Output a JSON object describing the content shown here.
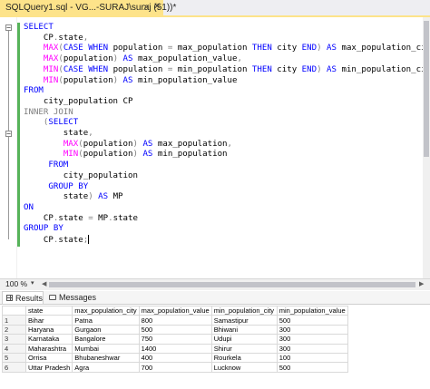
{
  "tab": {
    "title": "SQLQuery1.sql - VG...-SURAJ\\suraj (51))*"
  },
  "tab_icons": {
    "pin": "pin-icon",
    "close": "close-icon"
  },
  "code_lines": [
    [
      [
        "kw",
        "SELECT"
      ]
    ],
    [
      [
        "txt",
        "    CP"
      ],
      [
        "op",
        "."
      ],
      [
        "txt",
        "state"
      ],
      [
        "op",
        ","
      ]
    ],
    [
      [
        "txt",
        "    "
      ],
      [
        "fn",
        "MAX"
      ],
      [
        "op",
        "("
      ],
      [
        "kw",
        "CASE WHEN "
      ],
      [
        "txt",
        "population "
      ],
      [
        "op",
        "= "
      ],
      [
        "txt",
        "max_population "
      ],
      [
        "kw",
        "THEN "
      ],
      [
        "txt",
        "city "
      ],
      [
        "kw",
        "END"
      ],
      [
        "op",
        ") "
      ],
      [
        "kw",
        "AS "
      ],
      [
        "txt",
        "max_population_city"
      ],
      [
        "op",
        ","
      ]
    ],
    [
      [
        "txt",
        "    "
      ],
      [
        "fn",
        "MAX"
      ],
      [
        "op",
        "("
      ],
      [
        "txt",
        "population"
      ],
      [
        "op",
        ") "
      ],
      [
        "kw",
        "AS "
      ],
      [
        "txt",
        "max_population_value"
      ],
      [
        "op",
        ","
      ]
    ],
    [
      [
        "txt",
        "    "
      ],
      [
        "fn",
        "MIN"
      ],
      [
        "op",
        "("
      ],
      [
        "kw",
        "CASE WHEN "
      ],
      [
        "txt",
        "population "
      ],
      [
        "op",
        "= "
      ],
      [
        "txt",
        "min_population "
      ],
      [
        "kw",
        "THEN "
      ],
      [
        "txt",
        "city "
      ],
      [
        "kw",
        "END"
      ],
      [
        "op",
        ") "
      ],
      [
        "kw",
        "AS "
      ],
      [
        "txt",
        "min_population_city"
      ],
      [
        "op",
        ","
      ]
    ],
    [
      [
        "txt",
        "    "
      ],
      [
        "fn",
        "MIN"
      ],
      [
        "op",
        "("
      ],
      [
        "txt",
        "population"
      ],
      [
        "op",
        ") "
      ],
      [
        "kw",
        "AS "
      ],
      [
        "txt",
        "min_population_value"
      ]
    ],
    [
      [
        "kw",
        "FROM"
      ]
    ],
    [
      [
        "txt",
        "    city_population CP"
      ]
    ],
    [
      [
        "gr",
        "INNER JOIN"
      ]
    ],
    [
      [
        "txt",
        "    "
      ],
      [
        "op",
        "("
      ],
      [
        "kw",
        "SELECT"
      ]
    ],
    [
      [
        "txt",
        "        state"
      ],
      [
        "op",
        ","
      ]
    ],
    [
      [
        "txt",
        "        "
      ],
      [
        "fn",
        "MAX"
      ],
      [
        "op",
        "("
      ],
      [
        "txt",
        "population"
      ],
      [
        "op",
        ") "
      ],
      [
        "kw",
        "AS "
      ],
      [
        "txt",
        "max_population"
      ],
      [
        "op",
        ","
      ]
    ],
    [
      [
        "txt",
        "        "
      ],
      [
        "fn",
        "MIN"
      ],
      [
        "op",
        "("
      ],
      [
        "txt",
        "population"
      ],
      [
        "op",
        ") "
      ],
      [
        "kw",
        "AS "
      ],
      [
        "txt",
        "min_population"
      ]
    ],
    [
      [
        "txt",
        "     "
      ],
      [
        "kw",
        "FROM"
      ]
    ],
    [
      [
        "txt",
        "        city_population"
      ]
    ],
    [
      [
        "txt",
        "     "
      ],
      [
        "kw",
        "GROUP BY"
      ]
    ],
    [
      [
        "txt",
        "        state"
      ],
      [
        "op",
        ") "
      ],
      [
        "kw",
        "AS "
      ],
      [
        "txt",
        "MP"
      ]
    ],
    [
      [
        "kw",
        "ON"
      ]
    ],
    [
      [
        "txt",
        "    CP"
      ],
      [
        "op",
        "."
      ],
      [
        "txt",
        "state "
      ],
      [
        "op",
        "= "
      ],
      [
        "txt",
        "MP"
      ],
      [
        "op",
        "."
      ],
      [
        "txt",
        "state"
      ]
    ],
    [
      [
        "kw",
        "GROUP BY"
      ]
    ],
    [
      [
        "txt",
        "    CP"
      ],
      [
        "op",
        "."
      ],
      [
        "txt",
        "state"
      ],
      [
        "op",
        ";"
      ]
    ]
  ],
  "status": {
    "zoom": "100 %",
    "zoom_arrow": "▾",
    "scroll_left": "◀",
    "scroll_right": "▶"
  },
  "results_tabs": [
    {
      "label": "Results",
      "icon": "grid-icon"
    },
    {
      "label": "Messages",
      "icon": "messages-icon"
    }
  ],
  "results": {
    "columns": [
      "state",
      "max_population_city",
      "max_population_value",
      "min_population_city",
      "min_population_value"
    ],
    "rows": [
      [
        "1",
        "Bihar",
        "Patna",
        "800",
        "Samastipur",
        "500"
      ],
      [
        "2",
        "Haryana",
        "Gurgaon",
        "500",
        "Bhiwani",
        "300"
      ],
      [
        "3",
        "Karnataka",
        "Bangalore",
        "750",
        "Udupi",
        "300"
      ],
      [
        "4",
        "Maharashtra",
        "Mumbai",
        "1400",
        "Shirur",
        "300"
      ],
      [
        "5",
        "Orrisa",
        "Bhubaneshwar",
        "400",
        "Rourkela",
        "100"
      ],
      [
        "6",
        "Uttar Pradesh",
        "Agra",
        "700",
        "Lucknow",
        "500"
      ]
    ]
  },
  "colors": {
    "tab_active": "#fde38a",
    "keyword": "#0000ff",
    "function": "#ff00ff",
    "operator": "#808080",
    "change_bar": "#57b35a"
  }
}
